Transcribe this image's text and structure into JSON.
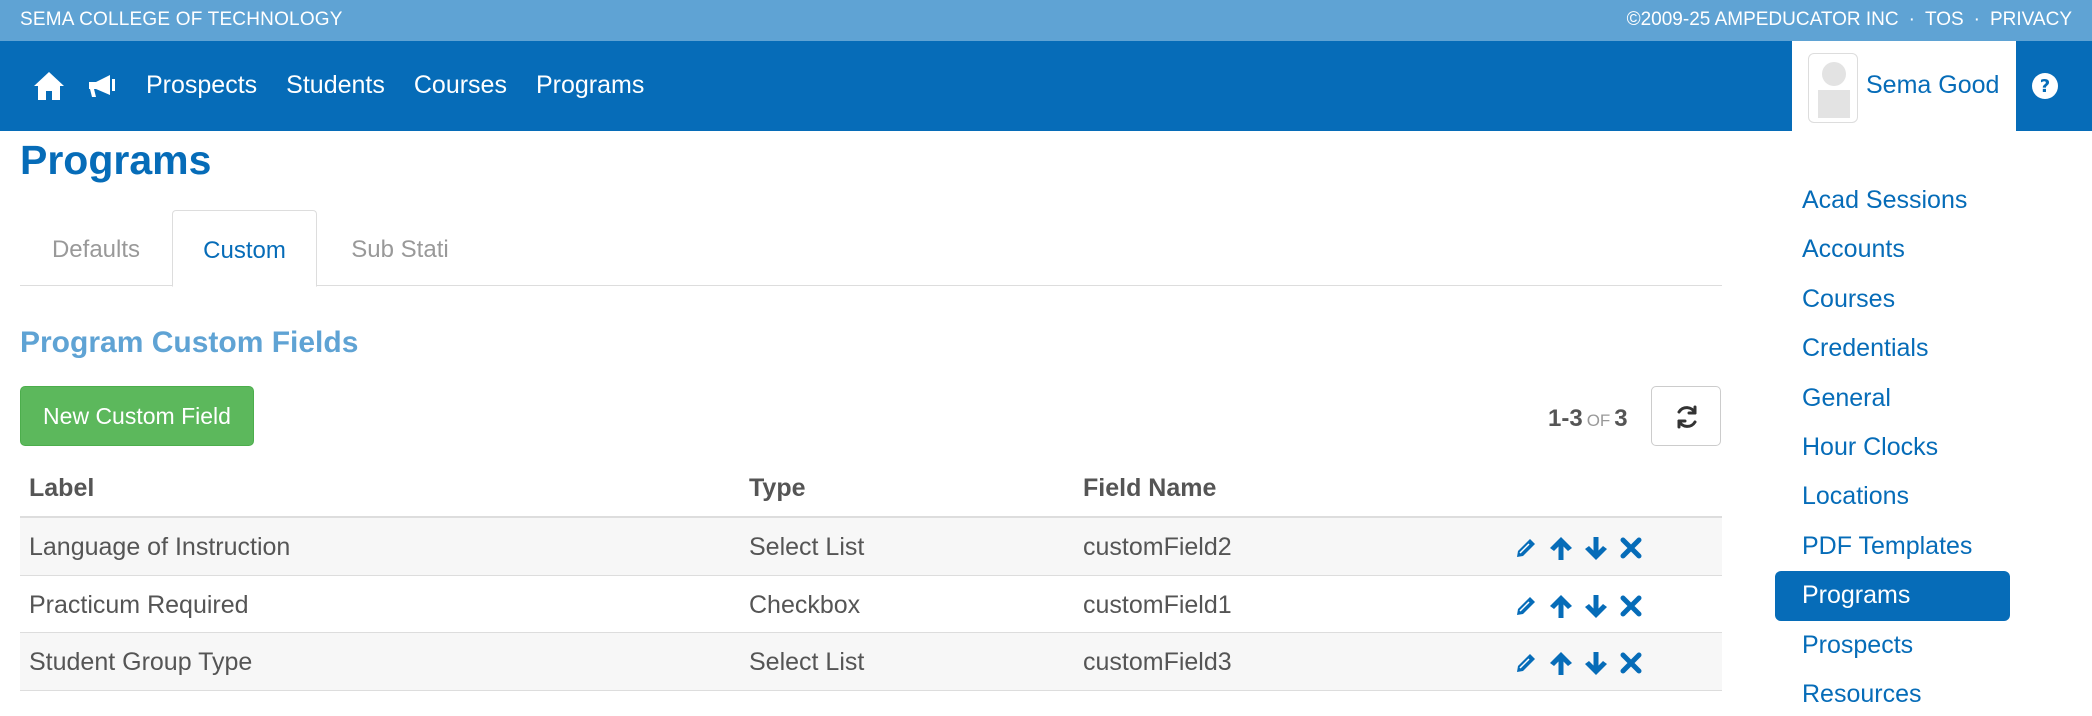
{
  "top_strip": {
    "school": "SEMA COLLEGE OF TECHNOLOGY",
    "copyright": "©2009-25 AMPEDUCATOR INC",
    "sep1": "·",
    "tos": "TOS",
    "sep2": "·",
    "privacy": "PRIVACY"
  },
  "nav": {
    "links": [
      "Prospects",
      "Students",
      "Courses",
      "Programs"
    ],
    "user_name": "Sema Good"
  },
  "page": {
    "title": "Programs",
    "tabs": [
      "Defaults",
      "Custom",
      "Sub Stati"
    ],
    "active_tab": "Custom",
    "section_title": "Program Custom Fields",
    "new_button": "New Custom Field"
  },
  "pager": {
    "range": "1-3",
    "of": "OF",
    "total": "3"
  },
  "table": {
    "headers": {
      "label": "Label",
      "type": "Type",
      "field_name": "Field Name"
    },
    "rows": [
      {
        "label": "Language of Instruction",
        "type": "Select List",
        "field_name": "customField2"
      },
      {
        "label": "Practicum Required",
        "type": "Checkbox",
        "field_name": "customField1"
      },
      {
        "label": "Student Group Type",
        "type": "Select List",
        "field_name": "customField3"
      }
    ]
  },
  "sidebar": {
    "items": [
      "Acad Sessions",
      "Accounts",
      "Courses",
      "Credentials",
      "General",
      "Hour Clocks",
      "Locations",
      "PDF Templates",
      "Programs",
      "Prospects",
      "Resources"
    ],
    "active": "Programs"
  },
  "icons": [
    "home-icon",
    "megaphone-icon",
    "question-circle-icon",
    "refresh-icon",
    "pencil-icon",
    "arrow-up-icon",
    "arrow-down-icon",
    "close-icon"
  ],
  "colors": {
    "primary": "#066cb8",
    "top_strip": "#5fa3d4",
    "success": "#5cb85c"
  }
}
